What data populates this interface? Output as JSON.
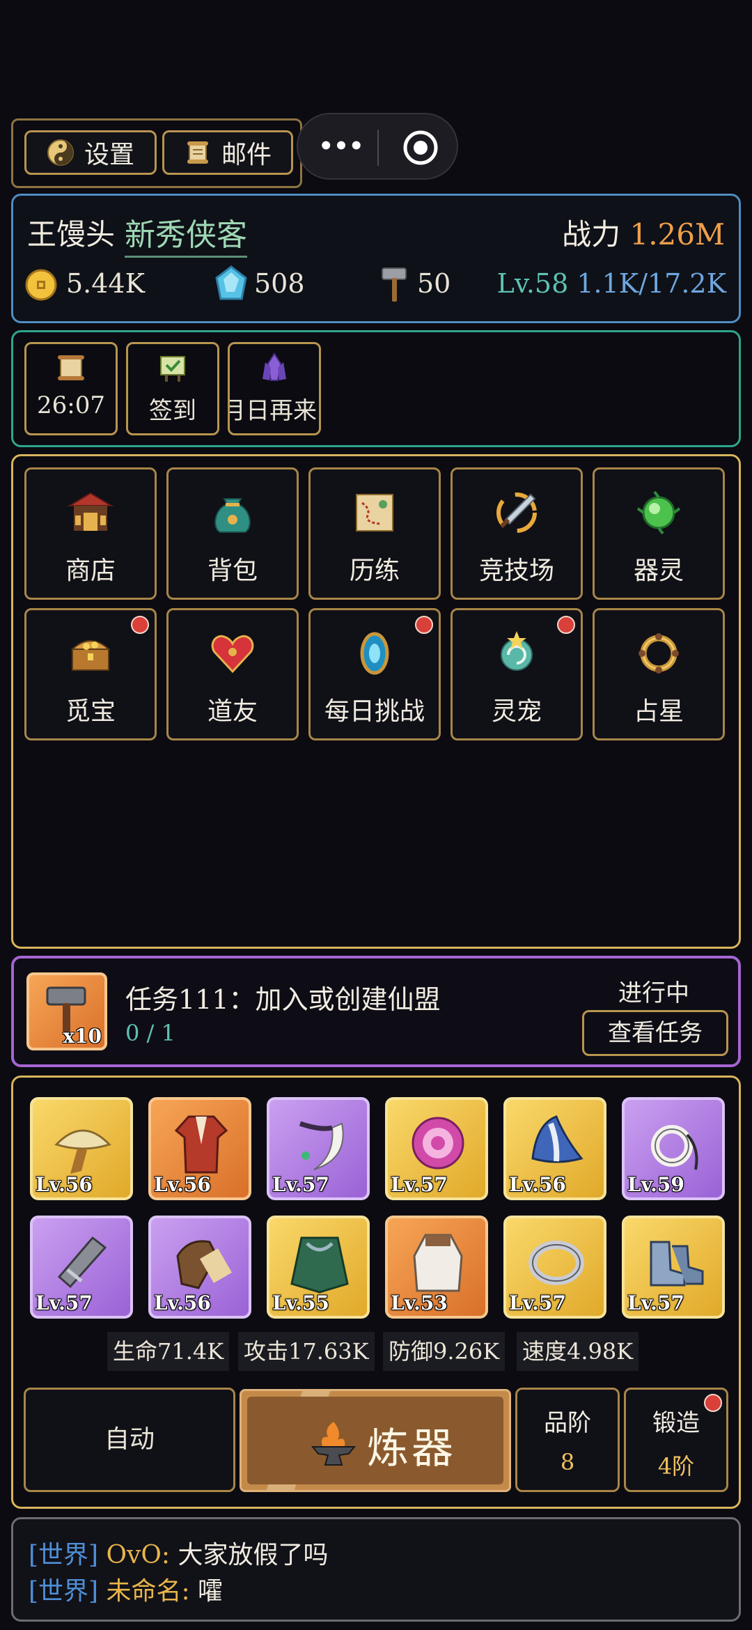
{
  "top_bar": {
    "settings_label": "设置",
    "mail_label": "邮件",
    "capsule_more": "•••"
  },
  "player": {
    "name": "王馒头",
    "title": "新秀侠客",
    "power_label": "战力",
    "power_value": "1.26M",
    "gold": "5.44K",
    "gems": "508",
    "hammers": "50",
    "level": "Lv.58",
    "exp": "1.1K/17.2K"
  },
  "quick_actions": [
    {
      "label": "26:07",
      "icon": "scroll-icon"
    },
    {
      "label": "签到",
      "icon": "sign-in-board-icon"
    },
    {
      "label": "月日再来",
      "icon": "crystal-icon"
    }
  ],
  "features": [
    {
      "label": "商店",
      "icon": "shop-pavilion-icon",
      "badge": false
    },
    {
      "label": "背包",
      "icon": "bag-icon",
      "badge": false
    },
    {
      "label": "历练",
      "icon": "map-icon",
      "badge": false
    },
    {
      "label": "竞技场",
      "icon": "sword-icon",
      "badge": false
    },
    {
      "label": "器灵",
      "icon": "green-orb-icon",
      "badge": false
    },
    {
      "label": "觅宝",
      "icon": "treasure-chest-icon",
      "badge": true
    },
    {
      "label": "道友",
      "icon": "heart-icon",
      "badge": false
    },
    {
      "label": "每日挑战",
      "icon": "mirror-icon",
      "badge": true
    },
    {
      "label": "灵宠",
      "icon": "star-swirl-icon",
      "badge": true
    },
    {
      "label": "占星",
      "icon": "ring-icon",
      "badge": false
    }
  ],
  "quest": {
    "reward_qty": "x10",
    "title": "任务111：加入或创建仙盟",
    "progress": "0 / 1",
    "status": "进行中",
    "view_button": "查看任务"
  },
  "equipment": [
    {
      "level": "Lv.56",
      "rarity": "gold",
      "icon": "hat-icon"
    },
    {
      "level": "Lv.56",
      "rarity": "orange",
      "icon": "robe-icon"
    },
    {
      "level": "Lv.57",
      "rarity": "purple",
      "icon": "crescent-blade-icon"
    },
    {
      "level": "Lv.57",
      "rarity": "gold",
      "icon": "amulet-icon"
    },
    {
      "level": "Lv.56",
      "rarity": "gold",
      "icon": "helmet-icon"
    },
    {
      "level": "Lv.59",
      "rarity": "purple",
      "icon": "necklace-icon"
    },
    {
      "level": "Lv.57",
      "rarity": "purple",
      "icon": "bracer-icon"
    },
    {
      "level": "Lv.56",
      "rarity": "purple",
      "icon": "glove-icon"
    },
    {
      "level": "Lv.55",
      "rarity": "gold",
      "icon": "cloak-icon"
    },
    {
      "level": "Lv.53",
      "rarity": "orange",
      "icon": "vest-icon"
    },
    {
      "level": "Lv.57",
      "rarity": "gold",
      "icon": "bangle-icon"
    },
    {
      "level": "Lv.57",
      "rarity": "gold",
      "icon": "boots-icon"
    }
  ],
  "stats": [
    {
      "label": "生命",
      "value": "71.4K"
    },
    {
      "label": "攻击",
      "value": "17.63K"
    },
    {
      "label": "防御",
      "value": "9.26K"
    },
    {
      "label": "速度",
      "value": "4.98K"
    }
  ],
  "actions": {
    "auto_label": "自动",
    "forge_label": "炼器",
    "grade_label": "品阶",
    "grade_value": "8",
    "smith_label": "锻造",
    "smith_value": "4阶"
  },
  "chat": [
    {
      "channel": "[世界]",
      "user": "OvO:",
      "message": "大家放假了吗"
    },
    {
      "channel": "[世界]",
      "user": "未命名:",
      "message": "嚯"
    }
  ],
  "colors": {
    "gold_border": "#b8954f",
    "player_border": "#4f8ec2",
    "quick_border": "#2fa58c",
    "quest_border": "#a565d2",
    "title_green": "#9fd8b4",
    "power_orange": "#f0a04b",
    "level_teal": "#5fc2b3",
    "exp_blue": "#6fa7e0",
    "channel_blue": "#4f8fd6",
    "user_gold": "#e8b54a"
  }
}
